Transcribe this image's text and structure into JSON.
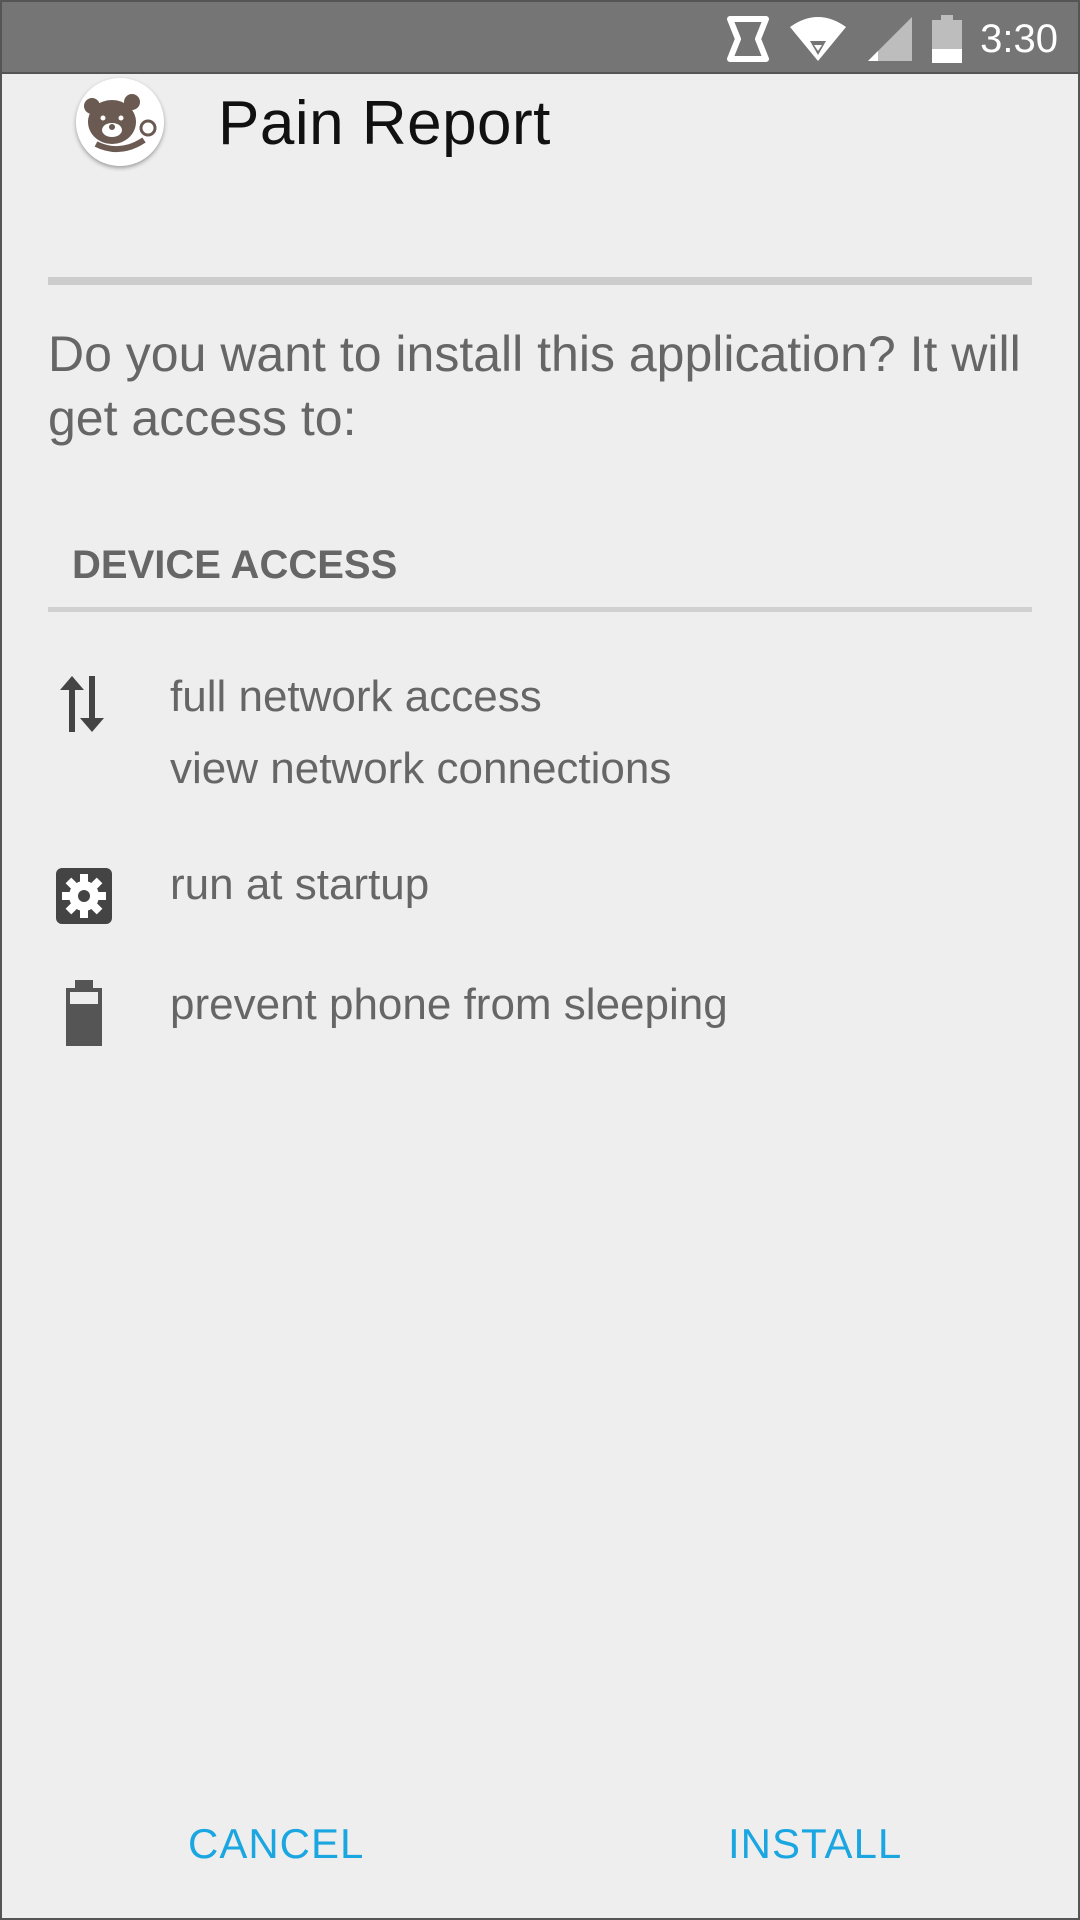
{
  "status_bar": {
    "time": "3:30",
    "icons": [
      "data-saver-icon",
      "wifi-icon",
      "cell-signal-icon",
      "battery-icon"
    ]
  },
  "dialog": {
    "app_name": "Pain Report",
    "app_icon": "teddy-bear-stethoscope-logo",
    "question": "Do you want to install this application? It will get access to:",
    "section_title": "DEVICE ACCESS",
    "permissions": [
      {
        "icon": "network-arrows-icon",
        "lines": [
          "full network access",
          "view network connections"
        ]
      },
      {
        "icon": "gear-icon",
        "lines": [
          "run at startup"
        ]
      },
      {
        "icon": "battery-icon",
        "lines": [
          "prevent phone from sleeping"
        ]
      }
    ],
    "buttons": {
      "cancel": "CANCEL",
      "install": "INSTALL"
    }
  },
  "colors": {
    "status_bar": "#757575",
    "background": "#eeeeee",
    "accent": "#1aa6e0",
    "text": "#666666",
    "title": "#111111"
  }
}
